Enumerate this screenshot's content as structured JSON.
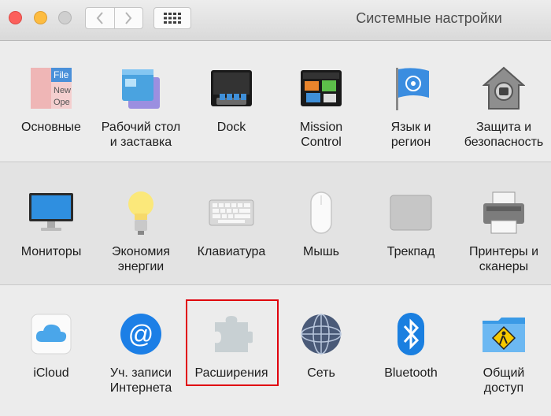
{
  "window": {
    "title": "Системные настройки"
  },
  "toolbar": {
    "back_icon": "chevron-left-icon",
    "forward_icon": "chevron-right-icon",
    "show_all_icon": "grid-icon"
  },
  "row1": [
    {
      "label": "Основные"
    },
    {
      "label": "Рабочий стол\nи заставка"
    },
    {
      "label": "Dock"
    },
    {
      "label": "Mission\nControl"
    },
    {
      "label": "Язык и\nрегион"
    },
    {
      "label": "Защита и\nбезопасность"
    }
  ],
  "row2": [
    {
      "label": "Мониторы"
    },
    {
      "label": "Экономия\nэнергии"
    },
    {
      "label": "Клавиатура"
    },
    {
      "label": "Мышь"
    },
    {
      "label": "Трекпад"
    },
    {
      "label": "Принтеры и\nсканеры"
    }
  ],
  "row3": [
    {
      "label": "iCloud"
    },
    {
      "label": "Уч. записи\nИнтернета"
    },
    {
      "label": "Расширения"
    },
    {
      "label": "Сеть"
    },
    {
      "label": "Bluetooth"
    },
    {
      "label": "Общий\nдоступ"
    }
  ],
  "general_icon_text": {
    "file": "File",
    "new": "New",
    "open": "Ope"
  }
}
